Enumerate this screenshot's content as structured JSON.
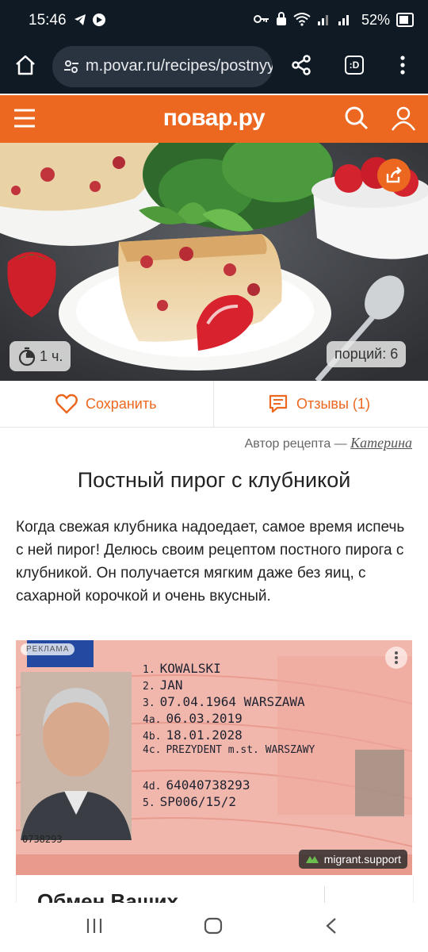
{
  "status_bar": {
    "time": "15:46",
    "battery": "52%"
  },
  "browser": {
    "url": "m.povar.ru/recipes/postnyy_pirog_s_klubnikoy",
    "tab_label": ":D"
  },
  "site": {
    "logo": "повар.ру"
  },
  "hero": {
    "time_label": "1 ч.",
    "portions_label": "порций: 6"
  },
  "actions": {
    "save_label": "Сохранить",
    "reviews_label": "Отзывы (1)"
  },
  "author": {
    "prefix": "Автор рецепта —",
    "name": "Катерина"
  },
  "recipe": {
    "title": "Постный пирог с клубникой",
    "description": "Когда свежая клубника надоедает, самое время испечь с ней пирог! Делюсь своим рецептом постного пирога с клубникой. Он получается мягким даже без яиц, с сахарной корочкой и очень вкусный."
  },
  "ad": {
    "badge": "РЕКЛАМА",
    "card_lines": [
      {
        "n": "1.",
        "text": "KOWALSKI"
      },
      {
        "n": "2.",
        "text": "JAN"
      },
      {
        "n": "3.",
        "text": "07.04.1964 WARSZAWA"
      },
      {
        "n": "4a.",
        "text": "06.03.2019"
      },
      {
        "n": "4b.",
        "text": "18.01.2028"
      },
      {
        "n": "4c.",
        "text": "PREZYDENT m.st. WARSZAWY"
      },
      {
        "n": "",
        "text": ""
      },
      {
        "n": "4d.",
        "text": "64040738293"
      },
      {
        "n": "5.",
        "text": "SP006/15/2"
      }
    ],
    "side_number": "0738293",
    "source": "migrant.support",
    "headline": "Обмен Ваших"
  },
  "colors": {
    "brand": "#ec6720",
    "status_bg": "#0f1a24"
  }
}
